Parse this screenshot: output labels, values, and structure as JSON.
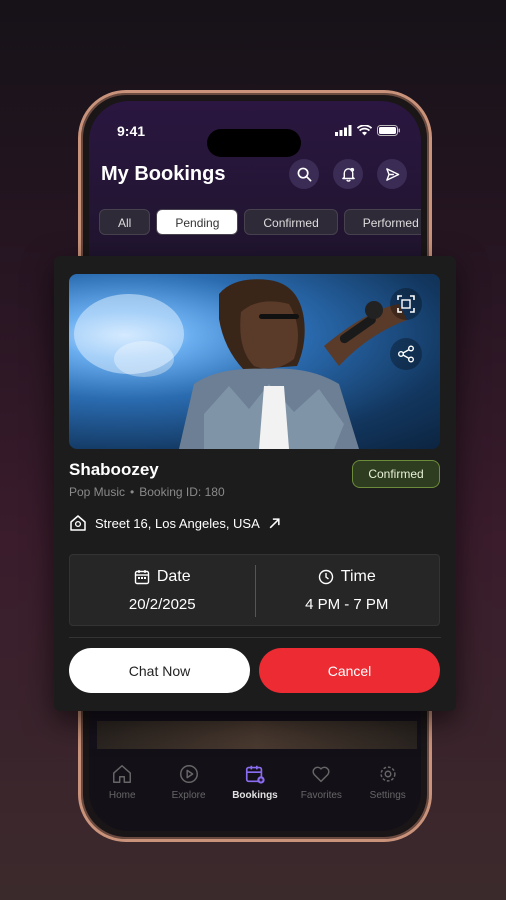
{
  "status_bar": {
    "time": "9:41"
  },
  "header": {
    "title": "My Bookings"
  },
  "tabs": [
    {
      "label": "All"
    },
    {
      "label": "Pending"
    },
    {
      "label": "Confirmed"
    },
    {
      "label": "Performed"
    }
  ],
  "active_tab": "Pending",
  "booking": {
    "artist": "Shaboozey",
    "genre": "Pop Music",
    "booking_id": "Booking ID: 180",
    "status": "Confirmed",
    "address": "Street 16, Los Angeles, USA",
    "date_label": "Date",
    "date_value": "20/2/2025",
    "time_label": "Time",
    "time_value": "4 PM - 7 PM",
    "chat_label": "Chat Now",
    "cancel_label": "Cancel"
  },
  "nav": [
    {
      "label": "Home",
      "icon": "home-icon"
    },
    {
      "label": "Explore",
      "icon": "play-circle-icon"
    },
    {
      "label": "Bookings",
      "icon": "calendar-icon"
    },
    {
      "label": "Favorites",
      "icon": "heart-icon"
    },
    {
      "label": "Settings",
      "icon": "gear-icon"
    }
  ],
  "active_nav": "Bookings",
  "colors": {
    "accent": "#ec2b33",
    "confirmed_badge": "#2e3d1f",
    "nav_active": "#8a6cf0"
  }
}
